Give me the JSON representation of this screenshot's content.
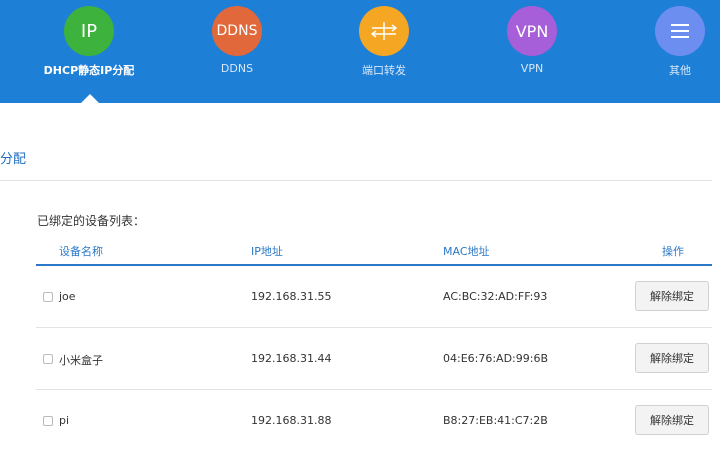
{
  "nav": {
    "items": [
      {
        "icon_text": "IP",
        "label": "DHCP静态IP分配",
        "color": "#3db33d",
        "active": true
      },
      {
        "icon_text": "DDNS",
        "label": "DDNS",
        "color": "#e0683a"
      },
      {
        "icon": "port-forward-icon",
        "label": "端口转发",
        "color": "#f5a623"
      },
      {
        "icon_text": "VPN",
        "label": "VPN",
        "color": "#a65fd8"
      },
      {
        "icon": "menu-icon",
        "label": "其他",
        "color": "#6b8ef0"
      }
    ],
    "bar_color": "#1e7fd6"
  },
  "section": {
    "title": "分配"
  },
  "list": {
    "title": "已绑定的设备列表：",
    "headers": {
      "name": "设备名称",
      "ip": "IP地址",
      "mac": "MAC地址",
      "action": "操作"
    },
    "rows": [
      {
        "name": "joe",
        "ip": "192.168.31.55",
        "mac": "AC:BC:32:AD:FF:93",
        "action": "解除绑定"
      },
      {
        "name": "小米盒子",
        "ip": "192.168.31.44",
        "mac": "04:E6:76:AD:99:6B",
        "action": "解除绑定"
      },
      {
        "name": "pi",
        "ip": "192.168.31.88",
        "mac": "B8:27:EB:41:C7:2B",
        "action": "解除绑定"
      }
    ]
  }
}
